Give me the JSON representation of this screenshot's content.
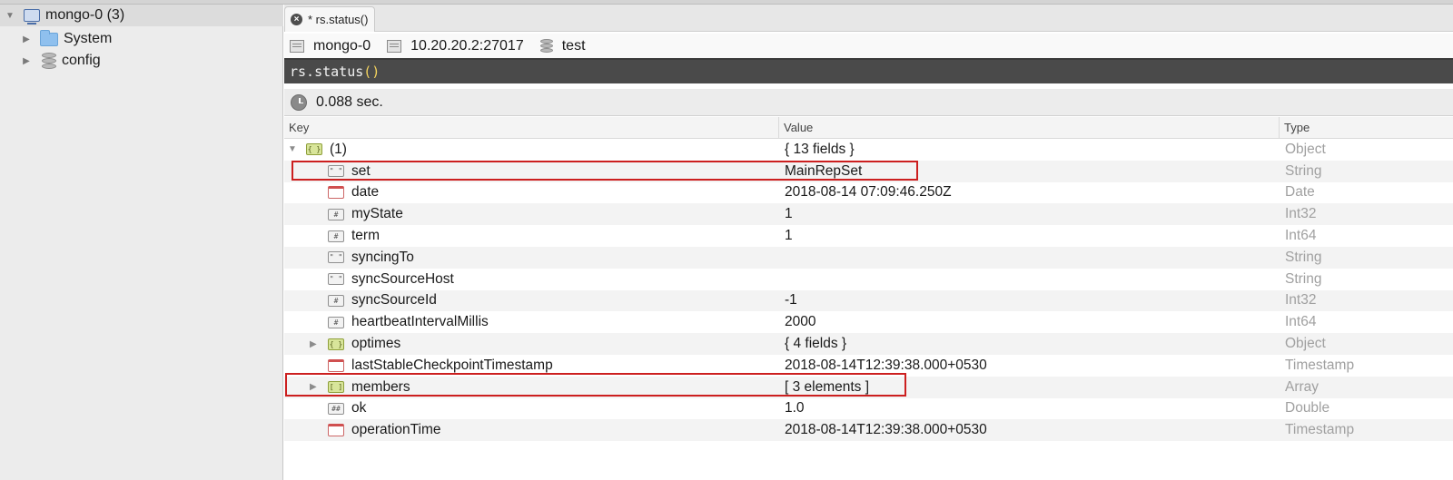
{
  "sidebar": {
    "root": {
      "label": "mongo-0 (3)",
      "icon": "server-icon"
    },
    "items": [
      {
        "label": "System",
        "icon": "folder-icon"
      },
      {
        "label": "config",
        "icon": "database-icon"
      }
    ]
  },
  "tab": {
    "label": "* rs.status()"
  },
  "connection": {
    "server": "mongo-0",
    "host": "10.20.20.2:27017",
    "database": "test"
  },
  "editor": {
    "code": "rs.status",
    "paren": "()"
  },
  "status": {
    "time": "0.088 sec."
  },
  "table": {
    "columns": {
      "key": "Key",
      "value": "Value",
      "type": "Type"
    },
    "rows": [
      {
        "key": "(1)",
        "value": "{ 13 fields }",
        "type": "Object",
        "icon": "object-icon",
        "level": 0,
        "disclosure": "expanded"
      },
      {
        "key": "set",
        "value": "MainRepSet",
        "type": "String",
        "icon": "string-icon",
        "level": 1,
        "highlighted": true
      },
      {
        "key": "date",
        "value": "2018-08-14 07:09:46.250Z",
        "type": "Date",
        "icon": "date-icon",
        "level": 1
      },
      {
        "key": "myState",
        "value": "1",
        "type": "Int32",
        "icon": "number-icon",
        "level": 1
      },
      {
        "key": "term",
        "value": "1",
        "type": "Int64",
        "icon": "number-icon",
        "level": 1
      },
      {
        "key": "syncingTo",
        "value": "",
        "type": "String",
        "icon": "string-icon",
        "level": 1
      },
      {
        "key": "syncSourceHost",
        "value": "",
        "type": "String",
        "icon": "string-icon",
        "level": 1
      },
      {
        "key": "syncSourceId",
        "value": "-1",
        "type": "Int32",
        "icon": "number-icon",
        "level": 1
      },
      {
        "key": "heartbeatIntervalMillis",
        "value": "2000",
        "type": "Int64",
        "icon": "number-icon",
        "level": 1
      },
      {
        "key": "optimes",
        "value": "{ 4 fields }",
        "type": "Object",
        "icon": "object-icon",
        "level": 1,
        "disclosure": "collapsed"
      },
      {
        "key": "lastStableCheckpointTimestamp",
        "value": "2018-08-14T12:39:38.000+0530",
        "type": "Timestamp",
        "icon": "date-icon",
        "level": 1
      },
      {
        "key": "members",
        "value": "[ 3 elements ]",
        "type": "Array",
        "icon": "array-icon",
        "level": 1,
        "disclosure": "collapsed",
        "highlighted": true
      },
      {
        "key": "ok",
        "value": "1.0",
        "type": "Double",
        "icon": "double-icon",
        "level": 1
      },
      {
        "key": "operationTime",
        "value": "2018-08-14T12:39:38.000+0530",
        "type": "Timestamp",
        "icon": "date-icon",
        "level": 1
      }
    ]
  },
  "colors": {
    "highlight": "#cc1f1f",
    "editor_bg": "#4a4a4a",
    "paren": "#f4d35e"
  }
}
